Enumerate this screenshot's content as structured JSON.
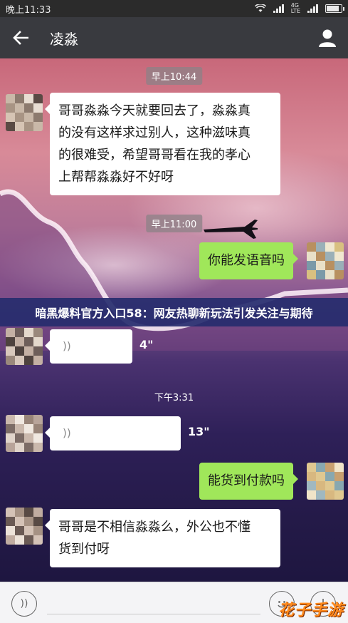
{
  "status_bar": {
    "time": "晚上11:33",
    "lte_top": "4G",
    "lte_bottom": "LTE",
    "battery_level": 0.9
  },
  "header": {
    "back_icon": "arrow-left-icon",
    "title": "凌淼",
    "profile_icon": "person-icon"
  },
  "chat": {
    "timestamps": [
      "早上10:44",
      "早上11:00",
      "下午3:31"
    ],
    "messages": [
      {
        "side": "in",
        "type": "text",
        "text": "哥哥淼淼今天就要回去了，淼淼真的没有这样求过别人，这种滋味真很难受，希望哥哥看在我的孝心上帮帮淼淼好不好呀"
      },
      {
        "side": "out",
        "type": "text",
        "text": "你能发语音吗"
      },
      {
        "side": "in",
        "type": "voice",
        "duration": "4\""
      },
      {
        "side": "in",
        "type": "voice",
        "duration": "13\""
      },
      {
        "side": "out",
        "type": "text",
        "text": "能货到付款吗"
      },
      {
        "side": "in",
        "type": "text",
        "text": "哥哥是不相信淼淼么，外公也不懂货到付呀"
      }
    ],
    "message_lines": {
      "m0": [
        "哥哥淼淼今天就要回去了，淼淼真",
        "的没有这样求过别人，这种滋味真",
        "的很难受，希望哥哥看在我的孝心",
        "上帮帮淼淼好不好呀"
      ],
      "m5": [
        "哥哥是不相信淼淼么，外公也不懂",
        "货到付呀"
      ]
    },
    "overlay_caption": "暗黑爆料官方入口58：网友热聊新玩法引发关注与期待"
  },
  "input_bar": {
    "voice_icon": "voice-icon",
    "emoji_icon": "emoji-icon",
    "plus_icon": "plus-icon"
  },
  "watermark": "花子手游",
  "colors": {
    "titlebar": "#393a3f",
    "incoming_bubble": "#ffffff",
    "outgoing_bubble": "#a0e75a",
    "watermark": "#ff8a1c"
  }
}
